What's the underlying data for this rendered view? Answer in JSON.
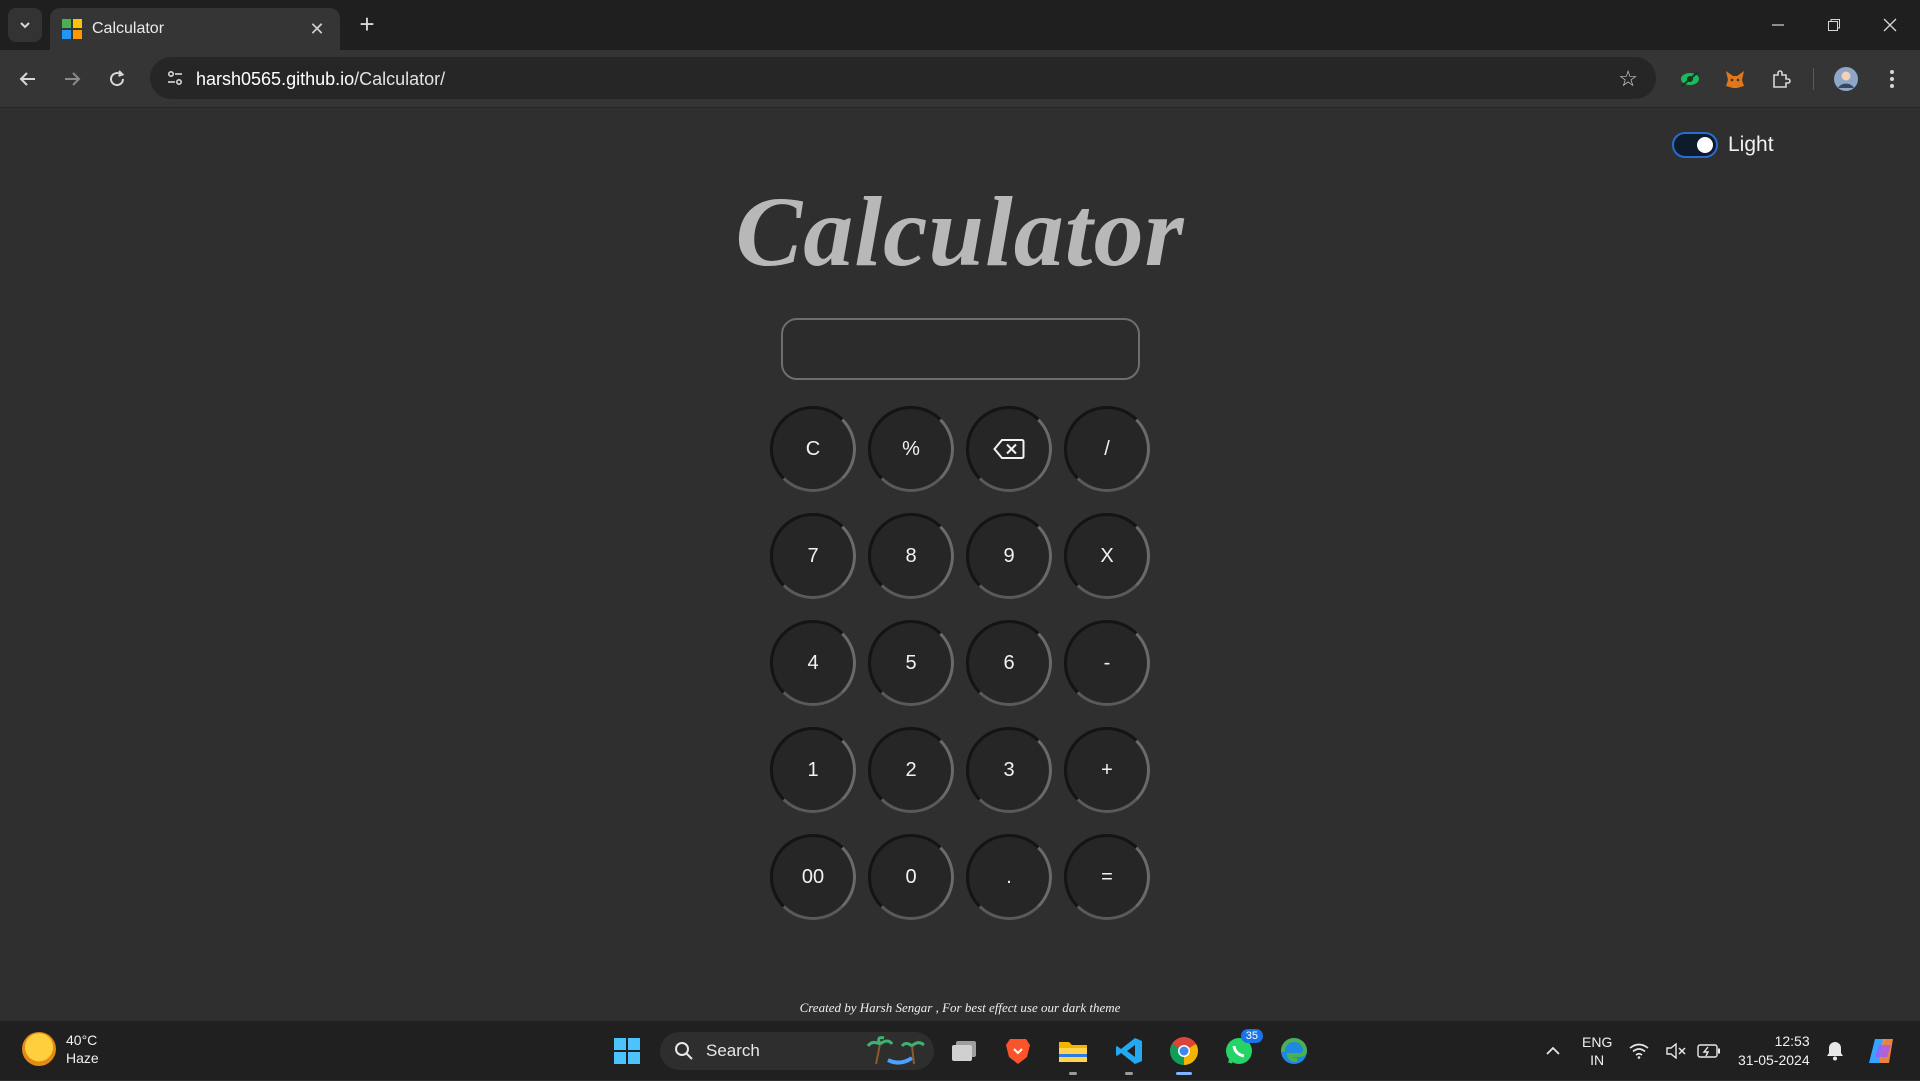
{
  "browser": {
    "tab_title": "Calculator",
    "new_tab": "+",
    "tab_close": "✕",
    "url_host": "harsh0565.github.io",
    "url_path": "/Calculator/"
  },
  "page": {
    "theme_label": "Light",
    "title": "Calculator",
    "display_value": "",
    "keys": [
      "C",
      "%",
      "⌫",
      "/",
      "7",
      "8",
      "9",
      "X",
      "4",
      "5",
      "6",
      "-",
      "1",
      "2",
      "3",
      "+",
      "00",
      "0",
      ".",
      "="
    ],
    "credit": "Created by Harsh Sengar , For best effect use our dark theme"
  },
  "taskbar": {
    "temperature": "40°C",
    "weather": "Haze",
    "search_label": "Search",
    "whatsapp_badge": "35",
    "lang_primary": "ENG",
    "lang_secondary": "IN",
    "time": "12:53",
    "date": "31-05-2024"
  },
  "colors": {
    "page_bg": "#2f2f2f",
    "key_bg": "#262626",
    "title": "#b8b8b8",
    "toggle_accent": "#2a6bd1"
  }
}
